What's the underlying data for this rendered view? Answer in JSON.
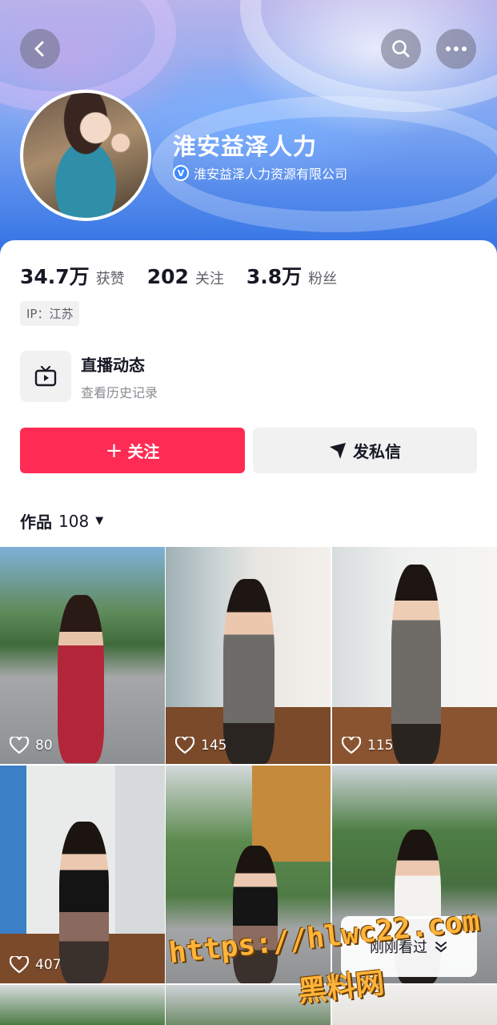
{
  "profile": {
    "name": "淮安益泽人力",
    "verified_label": "淮安益泽人力资源有限公司",
    "verified_badge": "V"
  },
  "stats": [
    {
      "value": "34.7万",
      "label": "获赞"
    },
    {
      "value": "202",
      "label": "关注"
    },
    {
      "value": "3.8万",
      "label": "粉丝"
    }
  ],
  "ip": "IP：江苏",
  "live": {
    "title": "直播动态",
    "subtitle": "查看历史记录"
  },
  "actions": {
    "follow": "关注",
    "follow_icon": "+",
    "message": "发私信"
  },
  "works": {
    "label": "作品",
    "count": "108",
    "caret": "▼"
  },
  "videos": [
    {
      "likes": "80"
    },
    {
      "likes": "145"
    },
    {
      "likes": "115"
    },
    {
      "likes": "407"
    },
    {
      "likes": ""
    },
    {
      "likes": ""
    }
  ],
  "recently_viewed": "刚刚看过",
  "watermark": {
    "url": "https://hlwc22.com",
    "site": "黑料网"
  },
  "colors": {
    "accent": "#fe2c55",
    "banner": "#2d6fe4",
    "text": "#161823",
    "muted": "#5f6068"
  },
  "icons": [
    "back-icon",
    "search-icon",
    "more-icon",
    "verified-icon",
    "tv-icon",
    "plus-icon",
    "send-icon",
    "heart-icon",
    "chevron-down-icon"
  ]
}
